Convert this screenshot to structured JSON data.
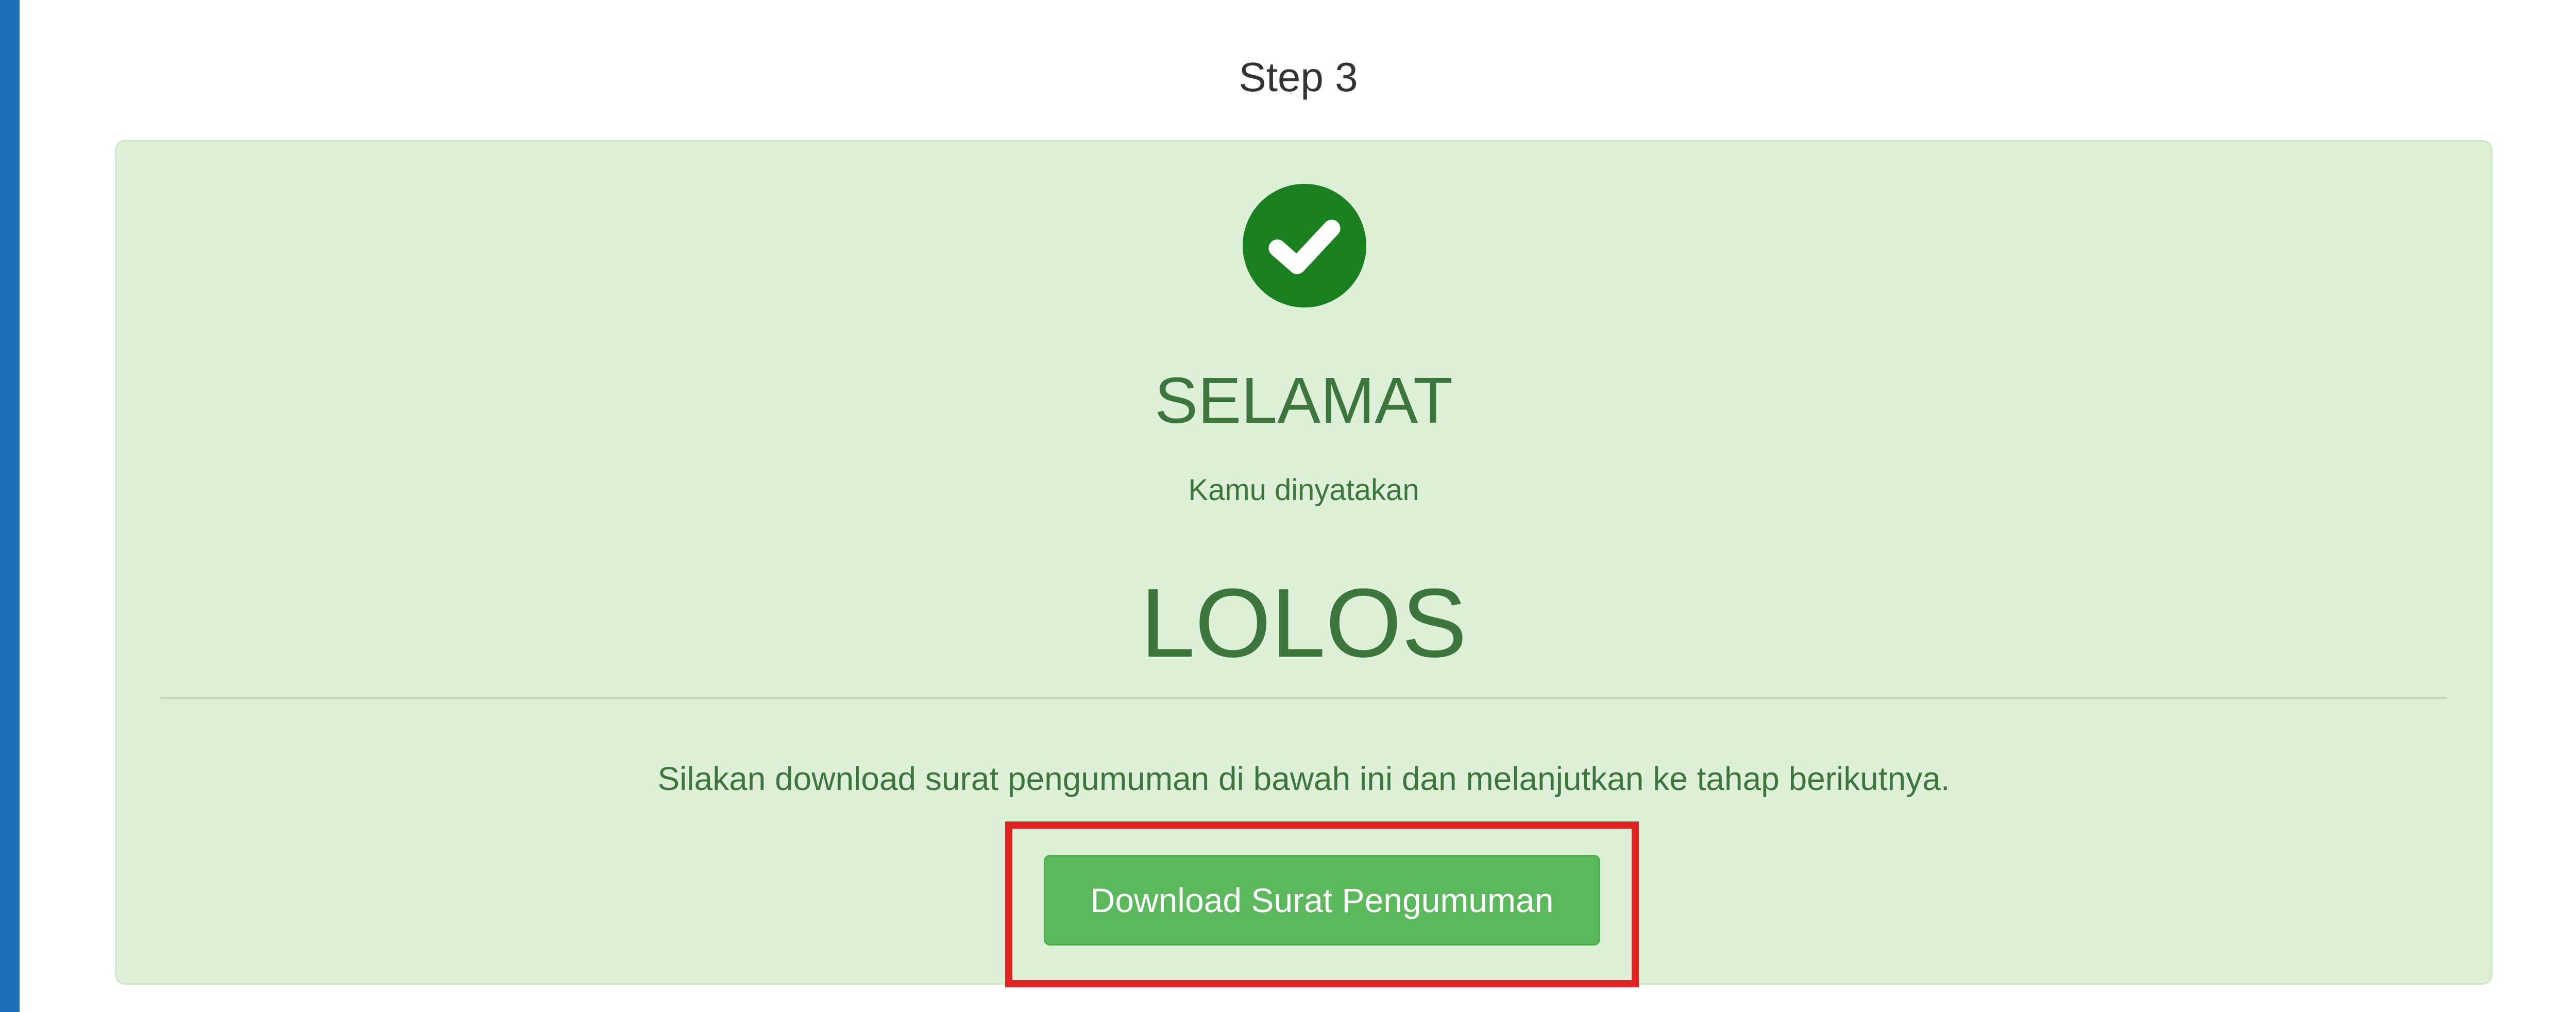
{
  "page": {
    "step_title": "Step 3"
  },
  "result_panel": {
    "icon": "check-circle-icon",
    "headline": "SELAMAT",
    "subline": "Kamu dinyatakan",
    "result": "LOLOS",
    "instruction": "Silakan download surat pengumuman di bawah ini dan melanjutkan ke tahap berikutnya.",
    "download_button_label": "Download Surat Pengumuman"
  },
  "colors": {
    "page_border": "#1f6fb8",
    "panel_background": "#dff0d8",
    "text_success": "#3c763d",
    "icon_green": "#1a7f1f",
    "button_green": "#5cb85c",
    "highlight_red": "#e02424"
  }
}
